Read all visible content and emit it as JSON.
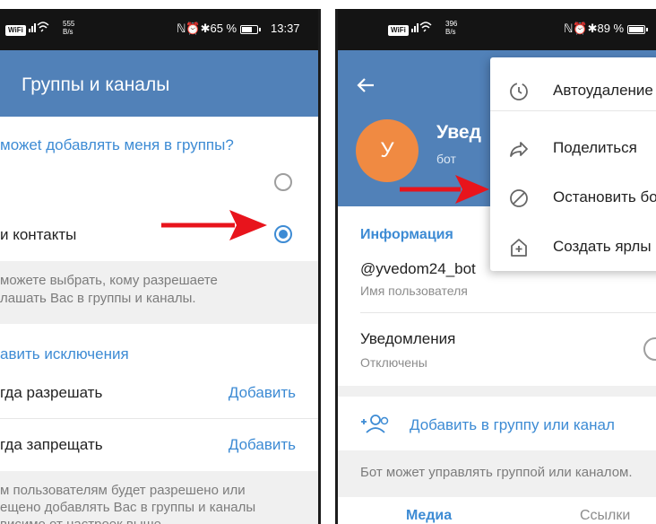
{
  "left": {
    "status": {
      "wifi": "WiFi",
      "speed_value": "555",
      "speed_unit": "B/s",
      "icons_text": "ℕ⏰✱65 %",
      "time": "13:37"
    },
    "header_title": "Группы и каналы",
    "question": "можеt добавлять меня в группы?",
    "option_contacts": "и контакты",
    "hint1_line1": "можете выбрать, кому разрешаете",
    "hint1_line2": "лашать Вас в группы и каналы.",
    "exceptions_title": "авить исключения",
    "always_allow": "гда разрешать",
    "never_allow": "гда запрещать",
    "add_label_1": "Добавить",
    "add_label_2": "Добавить",
    "hint2_line1": "м пользователям будет разрешено или",
    "hint2_line2": "ещено добавлять Вас в группы и каналы",
    "hint2_line3": "висимо от настроек выше."
  },
  "right": {
    "status": {
      "wifi": "WiFi",
      "speed_value": "396",
      "speed_unit": "B/s",
      "icons_text": "ℕ⏰✱89 %"
    },
    "avatar_letter": "У",
    "bot_name": "Увед",
    "bot_sub": "бот",
    "info_title": "Информация",
    "username": "@yvedom24_bot",
    "username_label": "Имя пользователя",
    "notifications": "Уведомления",
    "notifications_state": "Отключены",
    "add_to_group": "Добавить в группу или канал",
    "manage_hint": "Бот может управлять группой или каналом.",
    "tab_media": "Медиа",
    "tab_links": "Ссылки",
    "menu": [
      {
        "icon": "timer-icon",
        "label": "Автоудаление"
      },
      {
        "icon": "share-icon",
        "label": "Поделиться"
      },
      {
        "icon": "block-icon",
        "label": "Остановить бо"
      },
      {
        "icon": "add-shortcut-icon",
        "label": "Создать ярлы"
      }
    ]
  },
  "colors": {
    "header": "#5181b8",
    "accent": "#3d8bd4",
    "avatar": "#f08a42",
    "arrow": "#e8141c"
  }
}
